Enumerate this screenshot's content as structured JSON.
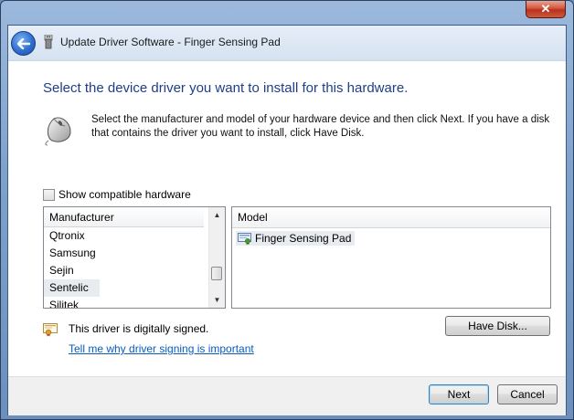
{
  "window": {
    "close_label": "✕",
    "title": "Update Driver Software - Finger Sensing Pad"
  },
  "instruction": "Select the device driver you want to install for this hardware.",
  "description": "Select the manufacturer and model of your hardware device and then click Next. If you have a disk that contains the driver you want to install, click Have Disk.",
  "compatible": {
    "label": "Show compatible hardware",
    "checked": false
  },
  "manufacturer_list": {
    "header": "Manufacturer",
    "items": [
      "Qtronix",
      "Samsung",
      "Sejin",
      "Sentelic",
      "Silitek"
    ],
    "selected": "Sentelic"
  },
  "model_list": {
    "header": "Model",
    "items": [
      "Finger Sensing Pad"
    ]
  },
  "signing": {
    "status": "This driver is digitally signed.",
    "link": "Tell me why driver signing is important"
  },
  "buttons": {
    "have_disk": "Have Disk...",
    "next": "Next",
    "cancel": "Cancel"
  },
  "colors": {
    "instruction_text": "#1e3e8a",
    "link": "#0a5bbd",
    "selection": "#e8ebef"
  }
}
